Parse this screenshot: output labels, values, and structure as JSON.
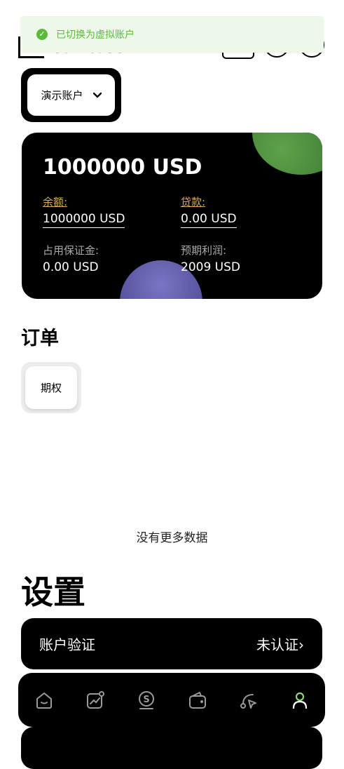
{
  "header": {
    "logo_text": "Coinbase"
  },
  "toast": {
    "message": "已切换为虚拟账户"
  },
  "account_selector": {
    "label": "演示账户"
  },
  "balance_card": {
    "total": "1000000 USD",
    "balance_label": "余额:",
    "balance_value": "1000000 USD",
    "loan_label": "贷款:",
    "loan_value": "0.00 USD",
    "margin_label": "占用保证金:",
    "margin_value": "0.00 USD",
    "profit_label": "预期利润:",
    "profit_value": "2009 USD"
  },
  "orders": {
    "title": "订单",
    "tab_label": "期权",
    "empty_text": "没有更多数据"
  },
  "settings": {
    "title": "设置",
    "verify_label": "账户验证",
    "verify_status": "未认证"
  },
  "tabbar": {
    "items": [
      "home-icon",
      "chart-icon",
      "coin-icon",
      "wallet-icon",
      "trade-icon",
      "user-icon"
    ],
    "active_color": "#8ed47a",
    "inactive_color": "#9a9a9a"
  }
}
